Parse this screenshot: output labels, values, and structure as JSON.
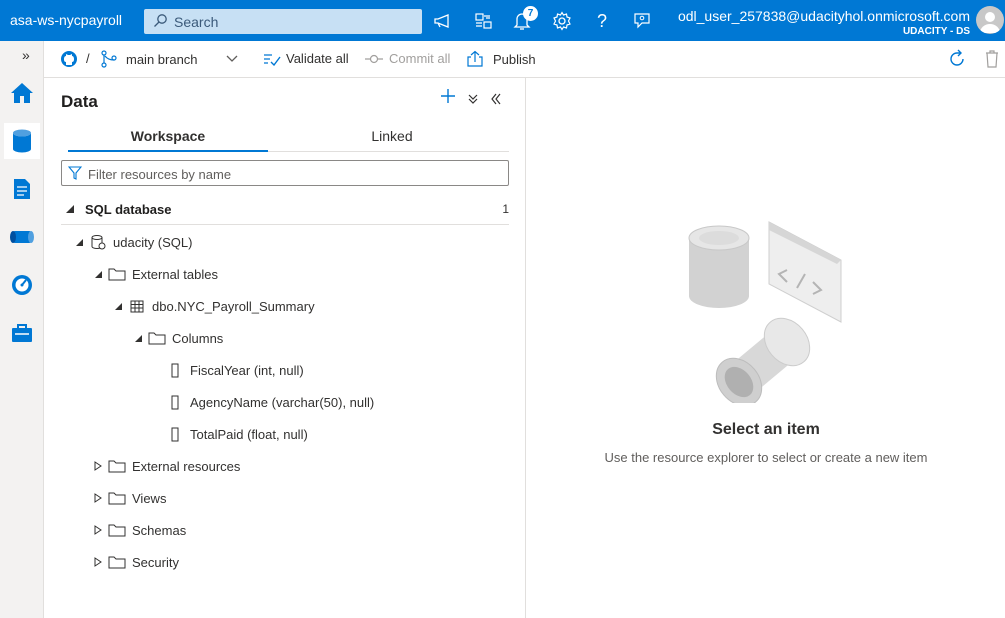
{
  "topbar": {
    "workspace_name": "asa-ws-nycpayroll",
    "search_placeholder": "Search",
    "notification_count": "7",
    "user_email": "odl_user_257838@udacityhol.onmicrosoft.com",
    "user_tenant": "UDACITY - DS",
    "icons": [
      "megaphone-icon",
      "directory-icon",
      "bell-icon",
      "gear-icon",
      "help-icon",
      "feedback-icon"
    ],
    "accent_color": "#0078d4"
  },
  "rail": {
    "expand_glyph": "»",
    "items": [
      "home-icon",
      "data-icon",
      "develop-icon",
      "integrate-icon",
      "monitor-icon",
      "manage-icon"
    ],
    "active": "data-icon"
  },
  "cmdbar": {
    "separator": "/",
    "branch_label": "main branch",
    "validate_label": "Validate all",
    "commit_label": "Commit all",
    "publish_label": "Publish"
  },
  "pane": {
    "title": "Data",
    "tabs": [
      {
        "label": "Workspace",
        "active": true
      },
      {
        "label": "Linked",
        "active": false
      }
    ],
    "filter_placeholder": "Filter resources by name",
    "section": {
      "name": "SQL database",
      "count": "1"
    },
    "tree": {
      "database": "udacity (SQL)",
      "external_tables": "External tables",
      "table": "dbo.NYC_Payroll_Summary",
      "columns_folder": "Columns",
      "columns": [
        "FiscalYear (int, null)",
        "AgencyName (varchar(50), null)",
        "TotalPaid (float, null)"
      ],
      "folders": [
        "External resources",
        "Views",
        "Schemas",
        "Security"
      ]
    }
  },
  "empty_state": {
    "heading": "Select an item",
    "description": "Use the resource explorer to select or create a new item"
  }
}
